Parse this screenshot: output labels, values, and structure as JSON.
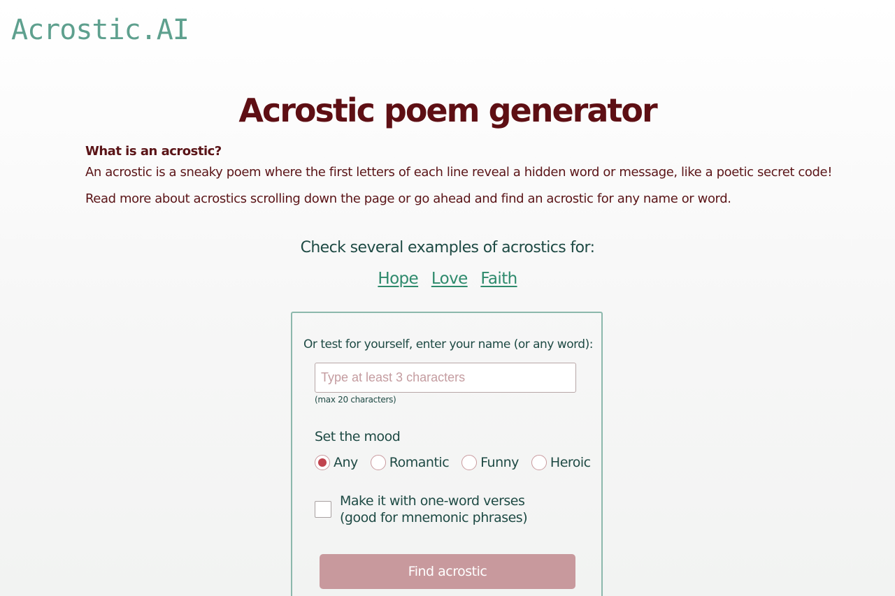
{
  "header": {
    "logo_text": "Acrostic.AI"
  },
  "main": {
    "title": "Acrostic poem generator",
    "intro": {
      "question": "What is an acrostic?",
      "text": "An acrostic is a sneaky poem where the first letters of each line reveal a hidden word or message, like a poetic secret code!",
      "read_more": "Read more about acrostics scrolling down the page or go ahead and find an acrostic for any name or word."
    },
    "examples": {
      "heading": "Check several examples of acrostics for:",
      "links": [
        "Hope",
        "Love",
        "Faith"
      ]
    },
    "form": {
      "prompt": "Or test for yourself, enter your name (or any word):",
      "input_placeholder": "Type at least 3 characters",
      "input_value": "",
      "max_note": "(max 20 characters)",
      "mood_label": "Set the mood",
      "moods": [
        "Any",
        "Romantic",
        "Funny",
        "Heroic"
      ],
      "selected_mood": "Any",
      "checkbox_line1": "Make it with one-word verses",
      "checkbox_line2": "(good for mnemonic phrases)",
      "checkbox_checked": false,
      "submit_label": "Find acrostic"
    }
  },
  "colors": {
    "logo": "#5ea08e",
    "title": "#5e0f14",
    "intro_text": "#5a1417",
    "teal_text": "#1e4a44",
    "link": "#2e8a6c",
    "form_border": "#8cb8ac",
    "radio_selected": "#c0434d",
    "button_bg": "#c8999d"
  }
}
